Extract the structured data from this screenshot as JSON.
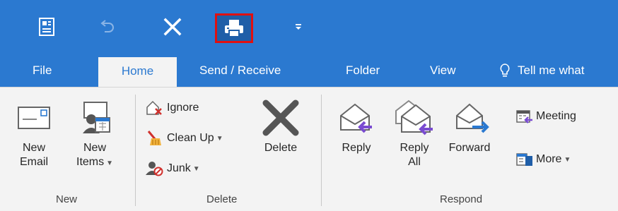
{
  "qat": {
    "save_icon": "save-icon",
    "undo_icon": "undo-icon",
    "close_icon": "close-icon",
    "print_icon": "print-icon",
    "customize_icon": "customize-icon"
  },
  "tabs": {
    "file": "File",
    "home": "Home",
    "send_receive": "Send / Receive",
    "folder": "Folder",
    "view": "View",
    "tell_me": "Tell me what"
  },
  "groups": {
    "new": {
      "label": "New",
      "new_email_line1": "New",
      "new_email_line2": "Email",
      "new_items_line1": "New",
      "new_items_line2": "Items"
    },
    "delete": {
      "label": "Delete",
      "ignore": "Ignore",
      "clean_up": "Clean Up",
      "junk": "Junk",
      "delete": "Delete"
    },
    "respond": {
      "label": "Respond",
      "reply": "Reply",
      "reply_all_line1": "Reply",
      "reply_all_line2": "All",
      "forward": "Forward",
      "meeting": "Meeting",
      "more": "More"
    }
  },
  "colors": {
    "ribbon_blue": "#2b79d0",
    "highlight_red": "#e01010",
    "ribbon_bg": "#f3f3f3"
  }
}
